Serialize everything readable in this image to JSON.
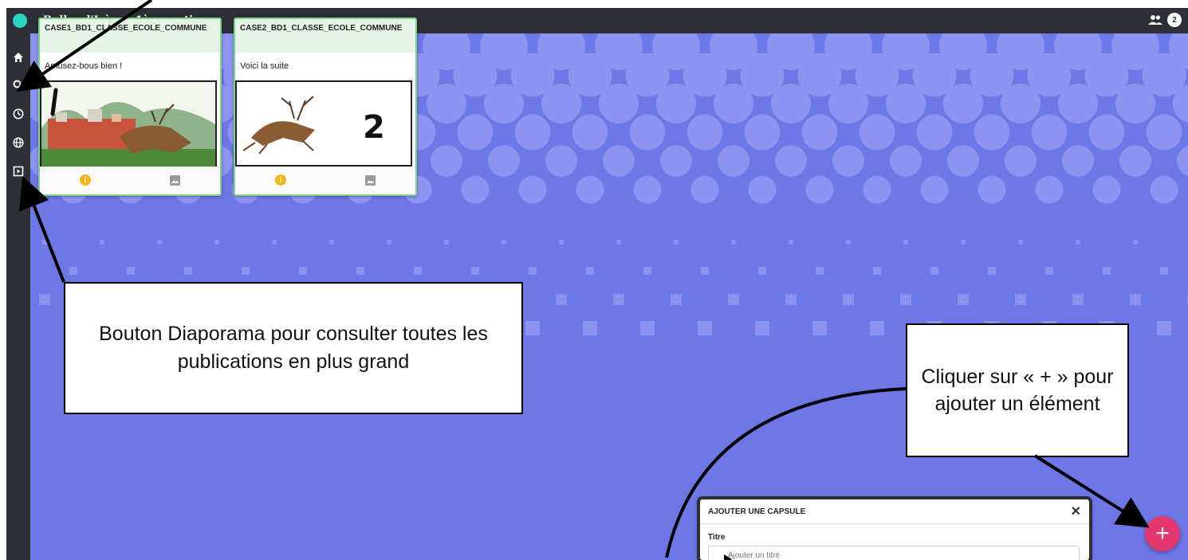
{
  "topbar": {
    "board_title": "Bulles d'Isère – 1ère partie",
    "users_icon": "users-icon",
    "users_count": "2",
    "logo_color": "#2ad3c2"
  },
  "sidebar": {
    "items": [
      {
        "icon": "home-icon"
      },
      {
        "icon": "search-icon"
      },
      {
        "icon": "clock-icon"
      },
      {
        "icon": "globe-icon"
      },
      {
        "icon": "slideshow-icon"
      }
    ]
  },
  "wall": {
    "background_color": "#6e77e6",
    "pattern_color": "#8c93f0"
  },
  "cards": [
    {
      "title": "CASE1_BD1_CLASSE_ECOLE_COMMUNE",
      "text": "Amusez-bous bien !",
      "number": "1",
      "border_color": "#7fd38a"
    },
    {
      "title": "CASE2_BD1_CLASSE_ECOLE_COMMUNE",
      "text": "Voici la suite",
      "number": "2",
      "border_color": "#7fd38a"
    }
  ],
  "callouts": {
    "diaporama": "Bouton Diaporama pour consulter toutes les publications en plus grand",
    "plus": "Cliquer sur « + » pour ajouter un élément"
  },
  "dialog": {
    "title": "AJOUTER UNE CAPSULE",
    "close_icon": "close-icon",
    "field_label": "Titre",
    "placeholder": "Ajouter un titre"
  },
  "fab": {
    "label": "+",
    "color": "#e3386f"
  }
}
